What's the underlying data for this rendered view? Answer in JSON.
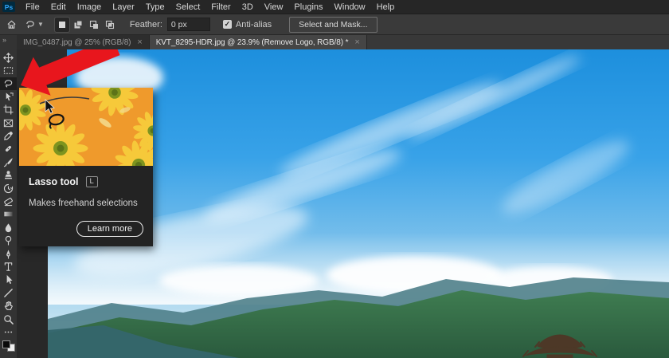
{
  "app": {
    "logo_text": "Ps"
  },
  "menubar": {
    "items": [
      "File",
      "Edit",
      "Image",
      "Layer",
      "Type",
      "Select",
      "Filter",
      "3D",
      "View",
      "Plugins",
      "Window",
      "Help"
    ]
  },
  "options": {
    "feather": {
      "label": "Feather:",
      "value": "0 px"
    },
    "anti_alias": {
      "label": "Anti-alias",
      "checked": true,
      "check_glyph": "✓"
    },
    "select_and_mask": {
      "label": "Select and Mask..."
    }
  },
  "tabbar": {
    "collapse_glyph": "»",
    "tabs": [
      {
        "label": "IMG_0487.jpg @ 25% (RGB/8)",
        "close_glyph": "×",
        "active": false
      },
      {
        "label": "KVT_8295-HDR.jpg @ 23.9% (Remove Logo, RGB/8) *",
        "close_glyph": "×",
        "active": true
      }
    ]
  },
  "toolbar": {
    "tools": [
      {
        "name": "move",
        "selected": false
      },
      {
        "name": "marquee",
        "selected": false
      },
      {
        "name": "lasso",
        "selected": true
      },
      {
        "name": "object-selection",
        "selected": false
      },
      {
        "name": "crop",
        "selected": false
      },
      {
        "name": "frame",
        "selected": false
      },
      {
        "name": "eyedropper",
        "selected": false
      },
      {
        "name": "spot-healing",
        "selected": false
      },
      {
        "name": "brush",
        "selected": false
      },
      {
        "name": "clone-stamp",
        "selected": false
      },
      {
        "name": "history-brush",
        "selected": false
      },
      {
        "name": "eraser",
        "selected": false
      },
      {
        "name": "gradient",
        "selected": false
      },
      {
        "name": "blur",
        "selected": false
      },
      {
        "name": "dodge",
        "selected": false
      },
      {
        "name": "pen",
        "selected": false
      },
      {
        "name": "type",
        "selected": false
      },
      {
        "name": "path-selection",
        "selected": false
      },
      {
        "name": "line",
        "selected": false
      },
      {
        "name": "hand",
        "selected": false
      },
      {
        "name": "zoom",
        "selected": false
      },
      {
        "name": "more-options",
        "selected": false
      }
    ]
  },
  "tooltip": {
    "title": "Lasso tool",
    "shortcut_key": "L",
    "description": "Makes freehand selections",
    "button": "Learn more"
  },
  "colors": {
    "accent_blue": "#31a8ff",
    "arrow_red": "#e8161d",
    "tooltip_image_bg": "#ef9a2c",
    "flower_yellow": "#f6c93a",
    "sky_top": "#1d8fdd",
    "mountain_green": "#35714a"
  }
}
